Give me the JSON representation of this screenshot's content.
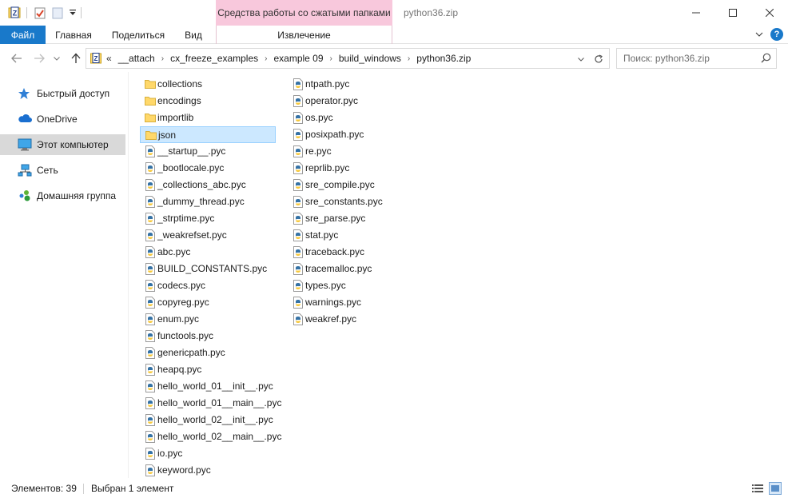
{
  "titlebar": {
    "context_tab_header": "Средства работы со сжатыми папками",
    "window_title": "python36.zip"
  },
  "ribbon": {
    "tabs": {
      "file": "Файл",
      "home": "Главная",
      "share": "Поделиться",
      "view": "Вид",
      "extract": "Извлечение"
    },
    "help": "?"
  },
  "nav": {
    "overflow": "«",
    "breadcrumbs": [
      "__attach",
      "cx_freeze_examples",
      "example 09",
      "build_windows",
      "python36.zip"
    ],
    "search_placeholder": "Поиск: python36.zip"
  },
  "sidebar": {
    "items": [
      {
        "label": "Быстрый доступ",
        "icon": "star-icon"
      },
      {
        "label": "OneDrive",
        "icon": "cloud-icon"
      },
      {
        "label": "Этот компьютер",
        "icon": "computer-icon"
      },
      {
        "label": "Сеть",
        "icon": "network-icon"
      },
      {
        "label": "Домашняя группа",
        "icon": "homegroup-icon"
      }
    ]
  },
  "files": {
    "column1": [
      {
        "name": "collections",
        "type": "folder"
      },
      {
        "name": "encodings",
        "type": "folder"
      },
      {
        "name": "importlib",
        "type": "folder"
      },
      {
        "name": "json",
        "type": "folder"
      },
      {
        "name": "__startup__.pyc",
        "type": "pyc"
      },
      {
        "name": "_bootlocale.pyc",
        "type": "pyc"
      },
      {
        "name": "_collections_abc.pyc",
        "type": "pyc"
      },
      {
        "name": "_dummy_thread.pyc",
        "type": "pyc"
      },
      {
        "name": "_strptime.pyc",
        "type": "pyc"
      },
      {
        "name": "_weakrefset.pyc",
        "type": "pyc"
      },
      {
        "name": "abc.pyc",
        "type": "pyc"
      },
      {
        "name": "BUILD_CONSTANTS.pyc",
        "type": "pyc"
      },
      {
        "name": "codecs.pyc",
        "type": "pyc"
      },
      {
        "name": "copyreg.pyc",
        "type": "pyc"
      },
      {
        "name": "enum.pyc",
        "type": "pyc"
      },
      {
        "name": "functools.pyc",
        "type": "pyc"
      },
      {
        "name": "genericpath.pyc",
        "type": "pyc"
      },
      {
        "name": "heapq.pyc",
        "type": "pyc"
      },
      {
        "name": "hello_world_01__init__.pyc",
        "type": "pyc"
      },
      {
        "name": "hello_world_01__main__.pyc",
        "type": "pyc"
      },
      {
        "name": "hello_world_02__init__.pyc",
        "type": "pyc"
      },
      {
        "name": "hello_world_02__main__.pyc",
        "type": "pyc"
      },
      {
        "name": "io.pyc",
        "type": "pyc"
      },
      {
        "name": "keyword.pyc",
        "type": "pyc"
      }
    ],
    "column2": [
      {
        "name": "ntpath.pyc",
        "type": "pyc"
      },
      {
        "name": "operator.pyc",
        "type": "pyc"
      },
      {
        "name": "os.pyc",
        "type": "pyc"
      },
      {
        "name": "posixpath.pyc",
        "type": "pyc"
      },
      {
        "name": "re.pyc",
        "type": "pyc"
      },
      {
        "name": "reprlib.pyc",
        "type": "pyc"
      },
      {
        "name": "sre_compile.pyc",
        "type": "pyc"
      },
      {
        "name": "sre_constants.pyc",
        "type": "pyc"
      },
      {
        "name": "sre_parse.pyc",
        "type": "pyc"
      },
      {
        "name": "stat.pyc",
        "type": "pyc"
      },
      {
        "name": "traceback.pyc",
        "type": "pyc"
      },
      {
        "name": "tracemalloc.pyc",
        "type": "pyc"
      },
      {
        "name": "types.pyc",
        "type": "pyc"
      },
      {
        "name": "warnings.pyc",
        "type": "pyc"
      },
      {
        "name": "weakref.pyc",
        "type": "pyc"
      }
    ],
    "selected": "json"
  },
  "status": {
    "count": "Элементов: 39",
    "selected": "Выбран 1 элемент"
  },
  "colors": {
    "accent": "#1979ca",
    "context_tab": "#f8c8dc",
    "selection": "#cce8ff",
    "folder": "#ffd86a"
  }
}
